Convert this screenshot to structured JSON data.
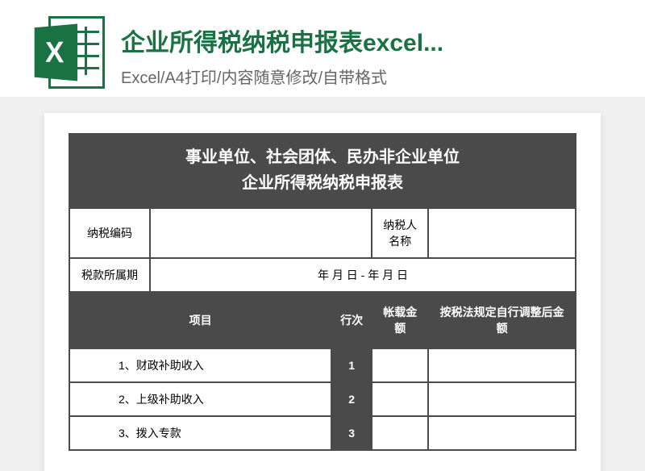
{
  "header": {
    "title": "企业所得税纳税申报表excel...",
    "subtitle": "Excel/A4打印/内容随意修改/自带格式",
    "icon_letter": "X"
  },
  "document": {
    "title_line1": "事业单位、社会团体、民办非企业单位",
    "title_line2": "企业所得税纳税申报表",
    "row1": {
      "label1": "纳税编码",
      "value1": "",
      "label2": "纳税人名称",
      "value2": ""
    },
    "row2": {
      "label1": "税款所属期",
      "value1": "年 月 日 -    年 月 日"
    },
    "columns": {
      "col1": "项目",
      "col2": "行次",
      "col3": "帐载金额",
      "col4": "按税法规定自行调整后金额"
    },
    "items": [
      {
        "text": "1、财政补助收入",
        "num": "1"
      },
      {
        "text": "2、上级补助收入",
        "num": "2"
      },
      {
        "text": "3、拨入专款",
        "num": "3"
      }
    ]
  }
}
